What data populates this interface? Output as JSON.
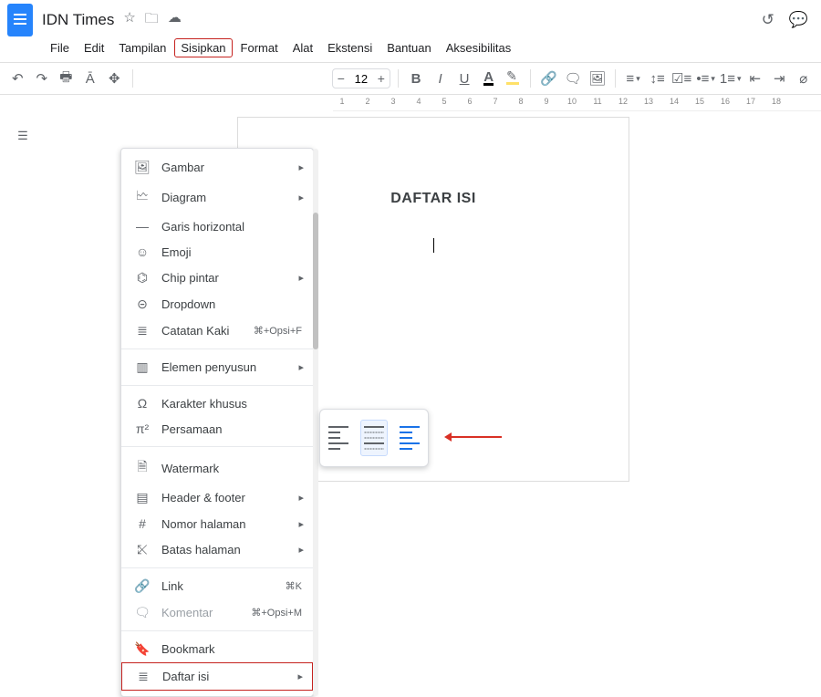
{
  "title": "IDN Times",
  "menubar": [
    "File",
    "Edit",
    "Tampilan",
    "Sisipkan",
    "Format",
    "Alat",
    "Ekstensi",
    "Bantuan",
    "Aksesibilitas"
  ],
  "toolbar": {
    "font_size": "12"
  },
  "ruler": [
    "1",
    "2",
    "3",
    "4",
    "5",
    "6",
    "7",
    "8",
    "9",
    "10",
    "11",
    "12",
    "13",
    "14",
    "15",
    "16",
    "17",
    "18"
  ],
  "dropdown": {
    "gambar": "Gambar",
    "diagram": "Diagram",
    "garis": "Garis horizontal",
    "emoji": "Emoji",
    "chip": "Chip pintar",
    "dropdown": "Dropdown",
    "catatan": "Catatan Kaki",
    "catatan_short": "⌘+Opsi+F",
    "elemen": "Elemen penyusun",
    "khusus": "Karakter khusus",
    "persamaan": "Persamaan",
    "watermark": "Watermark",
    "header": "Header & footer",
    "nomor": "Nomor halaman",
    "batas": "Batas halaman",
    "link": "Link",
    "link_short": "⌘K",
    "komentar": "Komentar",
    "komentar_short": "⌘+Opsi+M",
    "bookmark": "Bookmark",
    "daftar": "Daftar isi"
  },
  "page": {
    "heading": "DAFTAR ISI"
  }
}
